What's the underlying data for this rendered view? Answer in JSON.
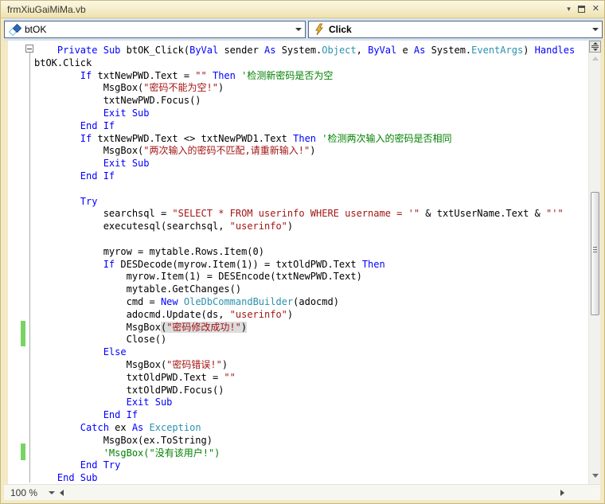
{
  "window": {
    "title": "frmXiuGaiMiMa.vb",
    "controls": {
      "menu": "▾",
      "close": "✕"
    }
  },
  "navbar": {
    "object_dropdown": {
      "value": "btOK",
      "icon": "vb-member-icon"
    },
    "event_dropdown": {
      "value": "Click",
      "icon": "event-lightning-icon"
    }
  },
  "statusbar": {
    "zoom_level": "100 %"
  },
  "colors": {
    "keyword": "#0000FF",
    "type": "#2B91AF",
    "string": "#A31515",
    "comment": "#008000",
    "plain": "#000000",
    "highlight": "#DCDCDC",
    "change_bar": "#77D463",
    "frame": "#F3E9C6",
    "navbar": "#D6E2F1"
  },
  "code": {
    "lines": [
      [
        [
          "p",
          "    "
        ],
        [
          "k",
          "Private"
        ],
        [
          "p",
          " "
        ],
        [
          "k",
          "Sub"
        ],
        [
          "p",
          " btOK_Click("
        ],
        [
          "k",
          "ByVal"
        ],
        [
          "p",
          " sender "
        ],
        [
          "k",
          "As"
        ],
        [
          "p",
          " System."
        ],
        [
          "t",
          "Object"
        ],
        [
          "p",
          ", "
        ],
        [
          "k",
          "ByVal"
        ],
        [
          "p",
          " e "
        ],
        [
          "k",
          "As"
        ],
        [
          "p",
          " System."
        ],
        [
          "t",
          "EventArgs"
        ],
        [
          "p",
          ") "
        ],
        [
          "k",
          "Handles"
        ]
      ],
      [
        [
          "p",
          "btOK.Click"
        ]
      ],
      [
        [
          "p",
          "        "
        ],
        [
          "k",
          "If"
        ],
        [
          "p",
          " txtNewPWD.Text = "
        ],
        [
          "s",
          "\"\""
        ],
        [
          "p",
          " "
        ],
        [
          "k",
          "Then"
        ],
        [
          "p",
          " "
        ],
        [
          "c",
          "'检测新密码是否为空"
        ]
      ],
      [
        [
          "p",
          "            MsgBox("
        ],
        [
          "s",
          "\"密码不能为空!\""
        ],
        [
          "p",
          ")"
        ]
      ],
      [
        [
          "p",
          "            txtNewPWD.Focus()"
        ]
      ],
      [
        [
          "p",
          "            "
        ],
        [
          "k",
          "Exit Sub"
        ]
      ],
      [
        [
          "p",
          "        "
        ],
        [
          "k",
          "End If"
        ]
      ],
      [
        [
          "p",
          "        "
        ],
        [
          "k",
          "If"
        ],
        [
          "p",
          " txtNewPWD.Text <> txtNewPWD1.Text "
        ],
        [
          "k",
          "Then"
        ],
        [
          "p",
          " "
        ],
        [
          "c",
          "'检测两次输入的密码是否相同"
        ]
      ],
      [
        [
          "p",
          "            MsgBox("
        ],
        [
          "s",
          "\"两次输入的密码不匹配,请重新输入!\""
        ],
        [
          "p",
          ")"
        ]
      ],
      [
        [
          "p",
          "            "
        ],
        [
          "k",
          "Exit Sub"
        ]
      ],
      [
        [
          "p",
          "        "
        ],
        [
          "k",
          "End If"
        ]
      ],
      [],
      [
        [
          "p",
          "        "
        ],
        [
          "k",
          "Try"
        ]
      ],
      [
        [
          "p",
          "            searchsql = "
        ],
        [
          "s",
          "\"SELECT * FROM userinfo WHERE username = '\""
        ],
        [
          "p",
          " & txtUserName.Text & "
        ],
        [
          "s",
          "\"'\""
        ]
      ],
      [
        [
          "p",
          "            executesql(searchsql, "
        ],
        [
          "s",
          "\"userinfo\""
        ],
        [
          "p",
          ")"
        ]
      ],
      [],
      [
        [
          "p",
          "            myrow = mytable.Rows.Item(0)"
        ]
      ],
      [
        [
          "p",
          "            "
        ],
        [
          "k",
          "If"
        ],
        [
          "p",
          " DESDecode(myrow.Item(1)) = txtOldPWD.Text "
        ],
        [
          "k",
          "Then"
        ]
      ],
      [
        [
          "p",
          "                myrow.Item(1) = DESEncode(txtNewPWD.Text)"
        ]
      ],
      [
        [
          "p",
          "                mytable.GetChanges()"
        ]
      ],
      [
        [
          "p",
          "                cmd = "
        ],
        [
          "k",
          "New"
        ],
        [
          "p",
          " "
        ],
        [
          "t",
          "OleDbCommandBuilder"
        ],
        [
          "p",
          "(adocmd)"
        ]
      ],
      [
        [
          "p",
          "                adocmd.Update(ds, "
        ],
        [
          "s",
          "\"userinfo\""
        ],
        [
          "p",
          ")"
        ]
      ],
      [
        [
          "p",
          "                MsgBox"
        ],
        [
          "hp",
          "("
        ],
        [
          "hs",
          "\"密码修改成功!\""
        ],
        [
          "hp",
          ")"
        ]
      ],
      [
        [
          "p",
          "                Close()"
        ]
      ],
      [
        [
          "p",
          "            "
        ],
        [
          "k",
          "Else"
        ]
      ],
      [
        [
          "p",
          "                MsgBox("
        ],
        [
          "s",
          "\"密码错误!\""
        ],
        [
          "p",
          ")"
        ]
      ],
      [
        [
          "p",
          "                txtOldPWD.Text = "
        ],
        [
          "s",
          "\"\""
        ]
      ],
      [
        [
          "p",
          "                txtOldPWD.Focus()"
        ]
      ],
      [
        [
          "p",
          "                "
        ],
        [
          "k",
          "Exit Sub"
        ]
      ],
      [
        [
          "p",
          "            "
        ],
        [
          "k",
          "End If"
        ]
      ],
      [
        [
          "p",
          "        "
        ],
        [
          "k",
          "Catch"
        ],
        [
          "p",
          " ex "
        ],
        [
          "k",
          "As"
        ],
        [
          "p",
          " "
        ],
        [
          "t",
          "Exception"
        ]
      ],
      [
        [
          "p",
          "            MsgBox(ex.ToString)"
        ]
      ],
      [
        [
          "p",
          "            "
        ],
        [
          "c",
          "'MsgBox(\"没有该用户!\")"
        ]
      ],
      [
        [
          "p",
          "        "
        ],
        [
          "k",
          "End Try"
        ]
      ],
      [
        [
          "p",
          "    "
        ],
        [
          "k",
          "End Sub"
        ]
      ]
    ]
  }
}
